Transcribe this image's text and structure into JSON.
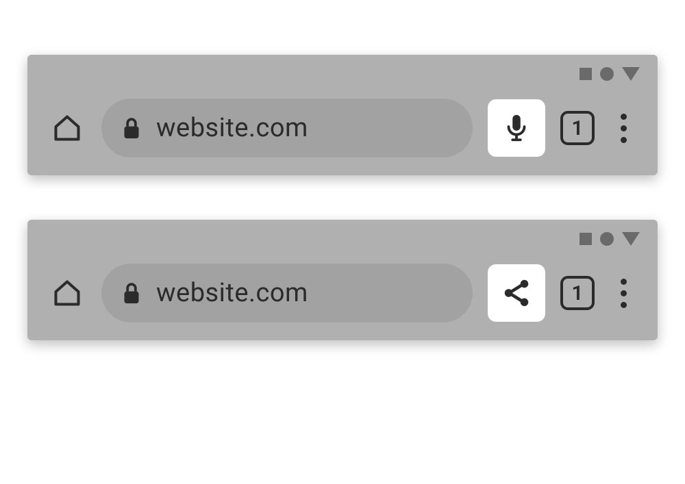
{
  "toolbars": [
    {
      "url": "website.com",
      "tab_count": "1",
      "action_icon": "microphone"
    },
    {
      "url": "website.com",
      "tab_count": "1",
      "action_icon": "share"
    }
  ],
  "colors": {
    "toolbar_bg": "#b0b0b0",
    "address_bg": "#a2a2a2",
    "icon_dark": "#2b2b2b",
    "status_icon": "#6a6a6a",
    "action_bg": "#ffffff"
  }
}
